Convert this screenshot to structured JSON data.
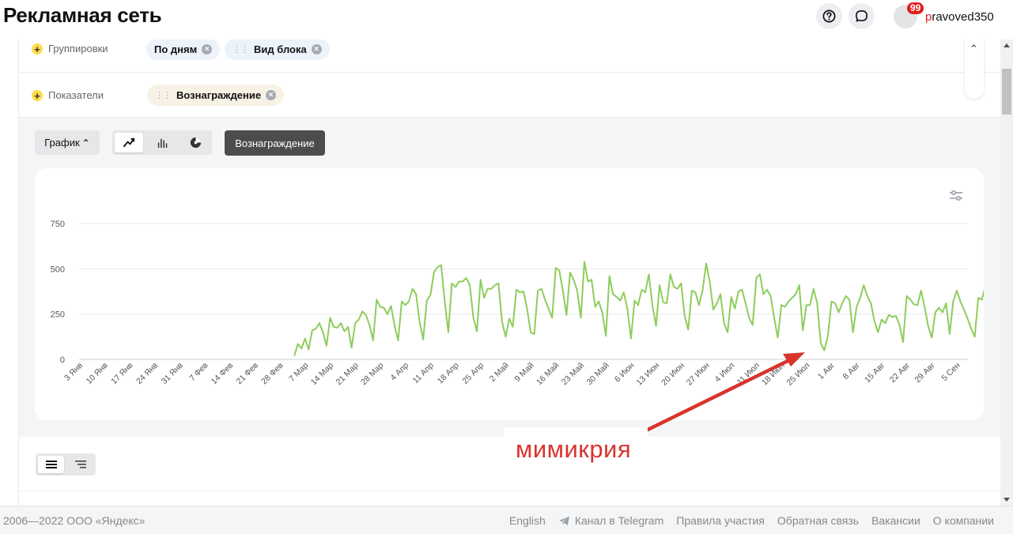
{
  "header": {
    "title": "Рекламная сеть",
    "notification_count": "99",
    "username_first": "p",
    "username_rest": "ravoved350"
  },
  "filters": {
    "groupings_label": "Группировки",
    "groupings": [
      "По дням",
      "Вид блока"
    ],
    "metrics_label": "Показатели",
    "metrics": [
      "Вознаграждение"
    ]
  },
  "toolbar": {
    "chart_button": "График",
    "metric_button": "Вознаграждение"
  },
  "chart_data": {
    "type": "line",
    "color": "#8dcd5c",
    "ylim": [
      0,
      750
    ],
    "yticks": [
      0,
      250,
      500,
      750
    ],
    "ytick_labels": [
      "0",
      "250",
      "500",
      "750"
    ],
    "xtick_labels": [
      "3 Янв",
      "10 Янв",
      "17 Янв",
      "24 Янв",
      "31 Янв",
      "7 Фев",
      "14 Фев",
      "21 Фев",
      "28 Фев",
      "7 Мар",
      "14 Мар",
      "21 Мар",
      "28 Мар",
      "4 Апр",
      "11 Апр",
      "18 Апр",
      "25 Апр",
      "2 Май",
      "9 Май",
      "16 Май",
      "23 Май",
      "30 Май",
      "6 Июн",
      "13 Июн",
      "20 Июн",
      "27 Июн",
      "4 Июл",
      "11 Июл",
      "18 Июл",
      "25 Июл",
      "1 Авг",
      "8 Авг",
      "15 Авг",
      "22 Авг",
      "29 Авг",
      "5 Сен"
    ],
    "series_start_label": "3 Мар",
    "values": [
      20,
      85,
      60,
      115,
      55,
      160,
      170,
      200,
      150,
      75,
      230,
      180,
      175,
      200,
      155,
      180,
      65,
      200,
      220,
      265,
      245,
      190,
      105,
      330,
      290,
      285,
      250,
      295,
      185,
      105,
      320,
      300,
      320,
      390,
      360,
      205,
      110,
      325,
      355,
      480,
      510,
      520,
      320,
      150,
      420,
      400,
      430,
      430,
      450,
      410,
      230,
      155,
      440,
      340,
      390,
      390,
      410,
      420,
      210,
      125,
      225,
      180,
      385,
      370,
      375,
      280,
      150,
      140,
      380,
      390,
      330,
      280,
      230,
      505,
      490,
      380,
      245,
      480,
      440,
      380,
      230,
      540,
      430,
      440,
      290,
      320,
      260,
      130,
      460,
      360,
      345,
      325,
      370,
      280,
      115,
      325,
      300,
      385,
      370,
      470,
      300,
      185,
      410,
      315,
      310,
      470,
      400,
      390,
      420,
      240,
      165,
      380,
      370,
      300,
      380,
      530,
      430,
      275,
      310,
      360,
      200,
      150,
      345,
      280,
      375,
      385,
      310,
      230,
      190,
      450,
      470,
      360,
      385,
      350,
      230,
      120,
      300,
      290,
      320,
      340,
      360,
      410,
      160,
      300,
      300,
      390,
      310,
      90,
      50,
      130,
      320,
      310,
      260,
      310,
      350,
      330,
      150,
      290,
      340,
      410,
      350,
      310,
      210,
      150,
      220,
      200,
      245,
      235,
      240,
      190,
      95,
      350,
      330,
      305,
      300,
      380,
      290,
      185,
      120,
      260,
      285,
      260,
      310,
      140,
      320,
      380,
      320,
      275,
      225,
      170,
      125,
      340,
      330,
      410,
      330,
      300,
      160
    ]
  },
  "annotation": {
    "text": "мимикрия",
    "arrow_color": "#d8342c"
  },
  "footer": {
    "copyright": "2006—2022 ООО «Яндекс»",
    "links": [
      "English",
      "Канал в Telegram",
      "Правила участия",
      "Обратная связь",
      "Вакансии",
      "О компании"
    ]
  }
}
